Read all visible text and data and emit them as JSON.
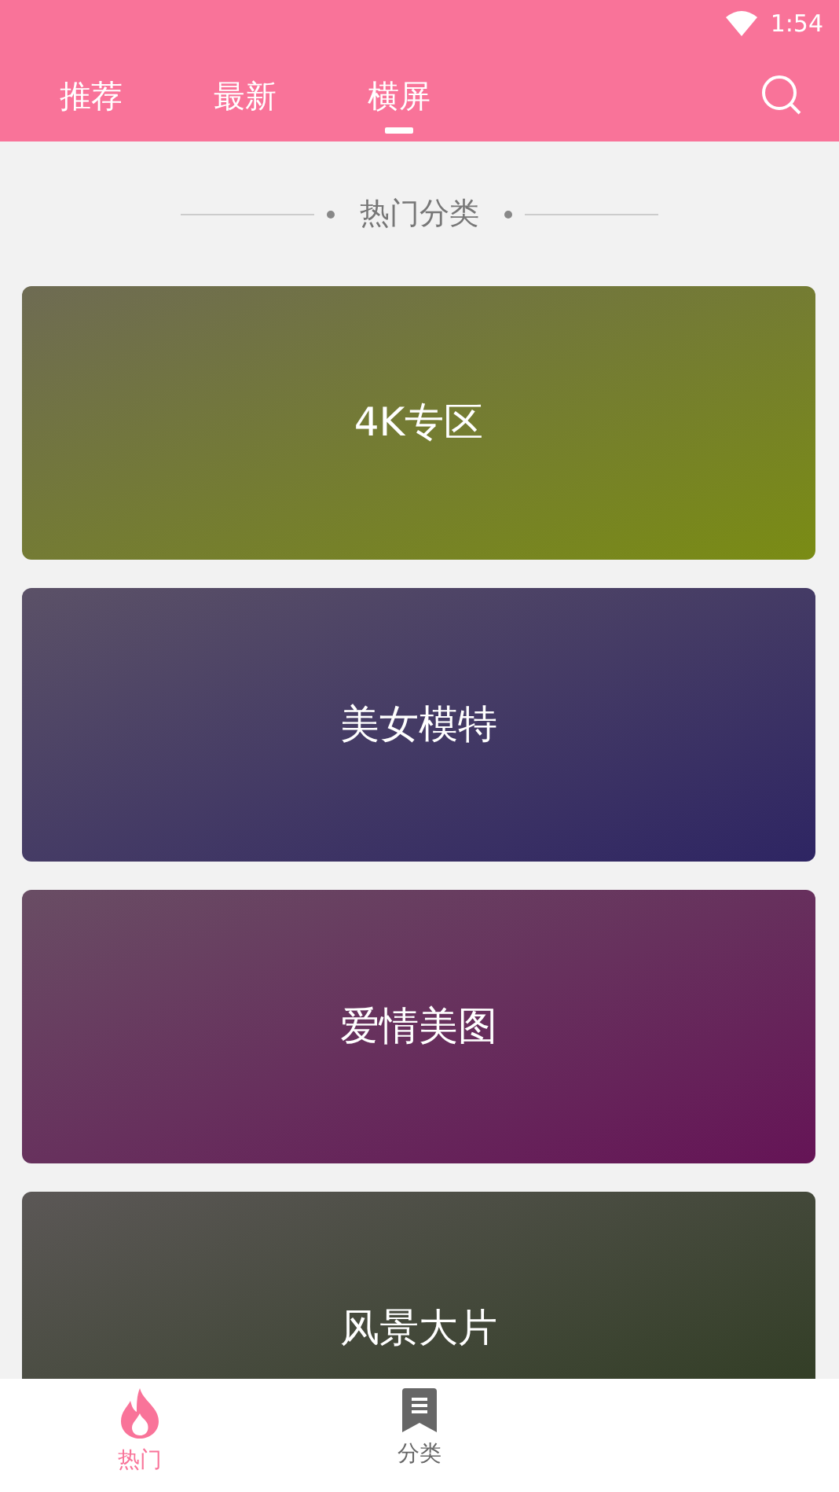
{
  "status_bar": {
    "time": "1:54"
  },
  "tabs": [
    {
      "label": "推荐",
      "selected": false
    },
    {
      "label": "最新",
      "selected": false
    },
    {
      "label": "横屏",
      "selected": true
    }
  ],
  "section": {
    "title": "热门分类"
  },
  "categories": [
    {
      "label": "4K专区",
      "color": "#7a8c14"
    },
    {
      "label": "美女模特",
      "color": "#2e2563"
    },
    {
      "label": "爱情美图",
      "color": "#651456"
    },
    {
      "label": "风景大片",
      "color": "#2c3a1e"
    }
  ],
  "bottom_nav": [
    {
      "label": "热门",
      "kind": "fire",
      "selected": true
    },
    {
      "label": "分类",
      "kind": "bookmark",
      "selected": false
    }
  ]
}
